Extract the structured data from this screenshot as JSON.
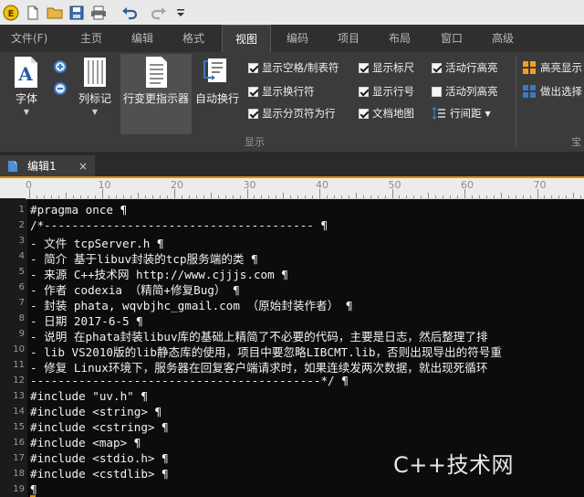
{
  "menu": {
    "tabs": [
      {
        "label": "文件(F)"
      },
      {
        "label": "主页"
      },
      {
        "label": "编辑"
      },
      {
        "label": "格式"
      },
      {
        "label": "视图"
      },
      {
        "label": "编码"
      },
      {
        "label": "项目"
      },
      {
        "label": "布局"
      },
      {
        "label": "窗口"
      },
      {
        "label": "高级"
      }
    ],
    "active_tab": "视图"
  },
  "ribbon": {
    "font_label": "字体",
    "column_marker_label": "列标记",
    "change_indicator_label": "行变更指示器",
    "word_wrap_label": "自动换行",
    "checks": [
      {
        "label": "显示空格/制表符",
        "checked": true
      },
      {
        "label": "显示换行符",
        "checked": true
      },
      {
        "label": "显示分页符为行",
        "checked": true
      },
      {
        "label": "显示标尺",
        "checked": true
      },
      {
        "label": "显示行号",
        "checked": true
      },
      {
        "label": "文档地图",
        "checked": true
      },
      {
        "label": "活动行高亮",
        "checked": true
      },
      {
        "label": "活动列高亮",
        "checked": false
      }
    ],
    "line_spacing_label": "行间距",
    "highlight_label": "高亮显示",
    "select_label": "做出选择",
    "group_display_label": "显示",
    "group_right_label": "宝"
  },
  "document_tab": {
    "label": "编辑1",
    "close": "×"
  },
  "ruler": {
    "numbers": [
      "0",
      "10",
      "20",
      "30",
      "40",
      "50",
      "60",
      "70"
    ]
  },
  "editor": {
    "lines": [
      {
        "n": "1",
        "text": "#pragma once ¶"
      },
      {
        "n": "2",
        "text": "/*--------------------------------------- ¶"
      },
      {
        "n": "3",
        "text": "- 文件 tcpServer.h ¶"
      },
      {
        "n": "4",
        "text": "- 简介 基于libuv封装的tcp服务端的类 ¶"
      },
      {
        "n": "5",
        "text": "- 来源 C++技术网 http://www.cjjjs.com ¶"
      },
      {
        "n": "6",
        "text": "- 作者 codexia （精简+修复Bug） ¶"
      },
      {
        "n": "7",
        "text": "- 封装 phata, wqvbjhc_gmail.com （原始封装作者） ¶"
      },
      {
        "n": "8",
        "text": "- 日期 2017-6-5 ¶"
      },
      {
        "n": "9",
        "text": "- 说明 在phata封装libuv库的基础上精简了不必要的代码，主要是日志，然后整理了排"
      },
      {
        "n": "10",
        "text": "- lib VS2010版的lib静态库的使用，项目中要忽略LIBCMT.lib，否则出现导出的符号重"
      },
      {
        "n": "11",
        "text": "- 修复 Linux环境下，服务器在回复客户端请求时，如果连续发两次数据，就出现死循环"
      },
      {
        "n": "12",
        "text": "------------------------------------------*/ ¶"
      },
      {
        "n": "13",
        "text": "#include \"uv.h\" ¶"
      },
      {
        "n": "14",
        "text": "#include <string> ¶"
      },
      {
        "n": "15",
        "text": "#include <cstring> ¶"
      },
      {
        "n": "16",
        "text": "#include <map> ¶"
      },
      {
        "n": "17",
        "text": "#include <stdio.h> ¶"
      },
      {
        "n": "18",
        "text": "#include <cstdlib> ¶"
      },
      {
        "n": "19",
        "text": "¶"
      }
    ]
  },
  "watermark": "C++技术网",
  "colors": {
    "accent": "#e08b00",
    "editor_bg": "#0c0c0c",
    "ribbon_bg": "#3b3b3b"
  }
}
